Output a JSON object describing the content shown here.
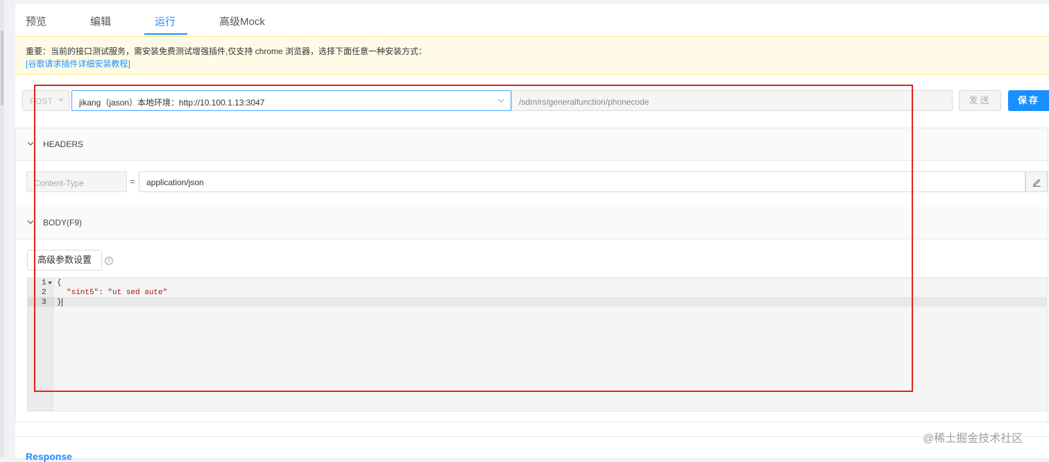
{
  "tabs": [
    "预览",
    "编辑",
    "运行",
    "高级Mock"
  ],
  "active_tab": "运行",
  "notice": {
    "line1": "重要：当前的接口测试服务，需安装免费测试增强插件,仅支持 chrome 浏览器，选择下面任意一种安装方式：",
    "link": "[谷歌请求插件详细安装教程]"
  },
  "request": {
    "method": "POST",
    "env": "jikang（jason）本地环境：http://10.100.1.13:3047",
    "path": "/sdm/rs/generalfunction/phonecode",
    "send_label": "发送",
    "save_label": "保存"
  },
  "headers_section": {
    "title": "HEADERS",
    "key": "Content-Type",
    "eq": "=",
    "value": "application/json"
  },
  "body_section": {
    "title": "BODY(F9)",
    "advanced_label": "高级参数设置",
    "code_lines": [
      {
        "num": "1",
        "text": "{"
      },
      {
        "num": "2",
        "key": "\"sint5\"",
        "sep": ": ",
        "val": "\"ut sed aute\""
      },
      {
        "num": "3",
        "text": "}"
      }
    ]
  },
  "response": {
    "title": "Response"
  },
  "watermark": "@稀土掘金技术社区",
  "colors": {
    "accent": "#1890ff",
    "highlight_box": "#e0201b",
    "notice_bg": "#fffbe6"
  }
}
